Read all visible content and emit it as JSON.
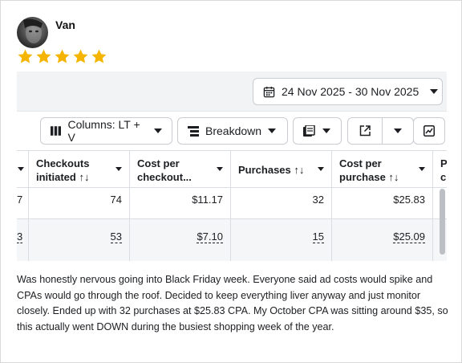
{
  "review": {
    "author": "Van",
    "rating": 5,
    "text": "Was honestly nervous going into Black Friday week. Everyone said ad costs would spike and CPAs would go through the roof. Decided to keep everything liver anyway and just monitor closely. Ended up with 32 purchases at $25.83 CPA. My October CPA was sitting around $35, so this actually went DOWN during the busiest shopping week of the year.",
    "star_color": "#f5b400"
  },
  "screenshot": {
    "date_range": "24 Nov 2025 - 30 Nov 2025",
    "toolbar": {
      "columns_label": "Columns: LT + V",
      "breakdown_label": "Breakdown"
    },
    "columns": [
      {
        "line1": "Checkouts",
        "line2": "initiated ↑↓"
      },
      {
        "line1": "Cost per",
        "line2": "checkout..."
      },
      {
        "line1": "Purchases ↑↓",
        "line2": ""
      },
      {
        "line1": "Cost per",
        "line2": "purchase ↑↓"
      },
      {
        "line1": "P",
        "line2": "c"
      }
    ],
    "rows": [
      {
        "prev": "7",
        "checkouts": "74",
        "cost_checkout": "$11.17",
        "purchases": "32",
        "cost_purchase": "$25.83"
      },
      {
        "prev": "3",
        "checkouts": "53",
        "cost_checkout": "$7.10",
        "purchases": "15",
        "cost_purchase": "$25.09"
      }
    ]
  }
}
